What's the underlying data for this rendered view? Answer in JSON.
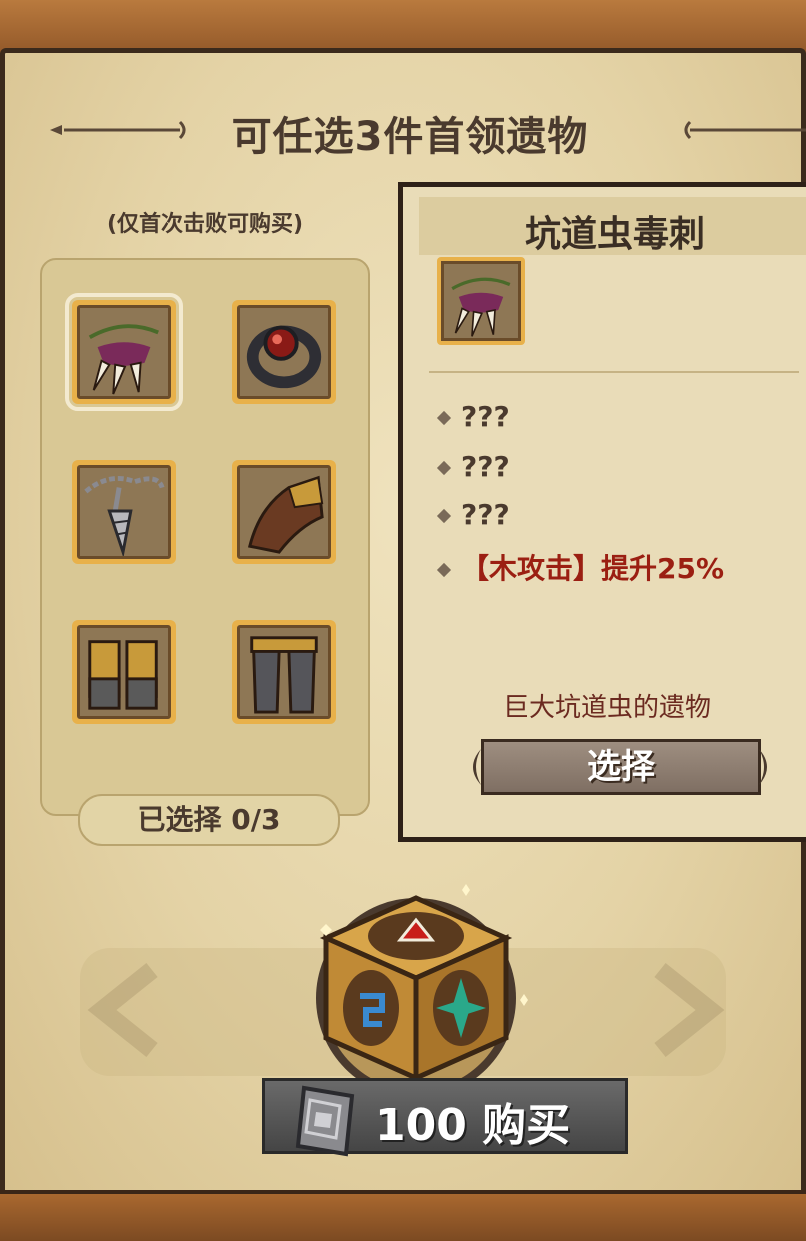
{
  "header": {
    "title": "可任选3件首领遗物"
  },
  "left_panel": {
    "subtitle": "(仅首次击败可购买)",
    "relics": [
      {
        "icon": "claw-necklace-icon",
        "selected": true
      },
      {
        "icon": "red-gem-ring-icon",
        "selected": false
      },
      {
        "icon": "chain-drill-amulet-icon",
        "selected": false
      },
      {
        "icon": "leather-gauntlet-icon",
        "selected": false
      },
      {
        "icon": "boots-icon",
        "selected": false
      },
      {
        "icon": "pants-icon",
        "selected": false
      }
    ],
    "selected_counter": "已选择 0/3"
  },
  "detail": {
    "name": "坑道虫毒刺",
    "icon": "claw-necklace-icon",
    "effects": [
      "???",
      "???",
      "???",
      "【木攻击】提升25%"
    ],
    "flavor": "巨大坑道虫的遗物",
    "select_label": "选择"
  },
  "purchase": {
    "price": "100",
    "label": "购买",
    "full_label": "100 购买",
    "chest_icon": "treasure-chest-icon",
    "coin_icon": "card-currency-icon"
  },
  "colors": {
    "parchment": "#e4d3a6",
    "frame": "#e8b14a",
    "text_dark": "#4a3a2e",
    "effect_red": "#9b1f12"
  }
}
